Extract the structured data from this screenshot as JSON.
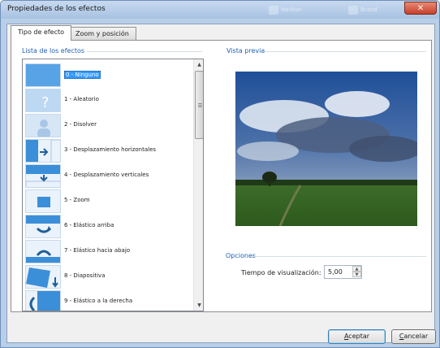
{
  "window": {
    "title": "Propiedades de los efectos",
    "background_hint": [
      "Navbar",
      "Brand"
    ],
    "close_glyph": "✕"
  },
  "tabs": [
    {
      "label": "Tipo de efecto",
      "active": true
    },
    {
      "label": "Zoom y posición",
      "active": false
    }
  ],
  "effects": {
    "group_label": "Lista de los efectos",
    "items": [
      {
        "label": "0 - Ninguno",
        "icon": "blank-thumb-icon",
        "selected": true
      },
      {
        "label": "1 - Aleatorio",
        "icon": "question-mark-icon"
      },
      {
        "label": "2 - Disolver",
        "icon": "dissolve-person-icon"
      },
      {
        "label": "3 - Desplazamiento horizontales",
        "icon": "arrow-right-icon"
      },
      {
        "label": "4 - Desplazamiento verticales",
        "icon": "arrow-down-icon"
      },
      {
        "label": "5 - Zoom",
        "icon": "zoom-square-icon"
      },
      {
        "label": "6 - Elástico arriba",
        "icon": "curved-arrow-up-icon"
      },
      {
        "label": "7 - Elástico hacia abajo",
        "icon": "curved-arrow-down-icon"
      },
      {
        "label": "8 - Diapositiva",
        "icon": "slide-icon"
      },
      {
        "label": "9 - Elástico a la derecha",
        "icon": "curved-arrow-right-icon"
      }
    ],
    "scroll_up": "▲",
    "scroll_down": "▼"
  },
  "preview": {
    "group_label": "Vista previa",
    "image_desc": "landscape-sky-field"
  },
  "options": {
    "group_label": "Opciones",
    "display_time_label": "Tiempo de visualización:",
    "display_time_value": "5,00",
    "spin_up": "▲",
    "spin_down": "▼"
  },
  "buttons": {
    "accept_first": "A",
    "accept_rest": "ceptar",
    "cancel_first": "C",
    "cancel_rest": "ancelar"
  },
  "colors": {
    "accent": "#1f5fb3",
    "selection": "#3399ff",
    "thumb_blue": "#3b8fd8"
  }
}
